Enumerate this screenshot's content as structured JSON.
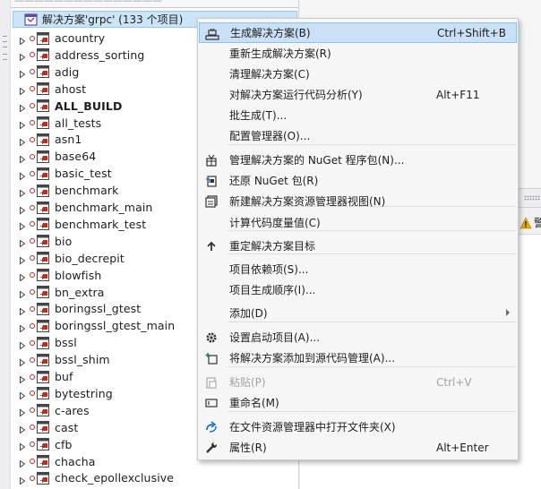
{
  "explorer": {
    "root": {
      "label": "解决方案'grpc' (133 个项目)"
    },
    "projects": [
      {
        "label": "acountry",
        "bold": false
      },
      {
        "label": "address_sorting",
        "bold": false
      },
      {
        "label": "adig",
        "bold": false
      },
      {
        "label": "ahost",
        "bold": false
      },
      {
        "label": "ALL_BUILD",
        "bold": true
      },
      {
        "label": "all_tests",
        "bold": false
      },
      {
        "label": "asn1",
        "bold": false
      },
      {
        "label": "base64",
        "bold": false
      },
      {
        "label": "basic_test",
        "bold": false
      },
      {
        "label": "benchmark",
        "bold": false
      },
      {
        "label": "benchmark_main",
        "bold": false
      },
      {
        "label": "benchmark_test",
        "bold": false
      },
      {
        "label": "bio",
        "bold": false
      },
      {
        "label": "bio_decrepit",
        "bold": false
      },
      {
        "label": "blowfish",
        "bold": false
      },
      {
        "label": "bn_extra",
        "bold": false
      },
      {
        "label": "boringssl_gtest",
        "bold": false
      },
      {
        "label": "boringssl_gtest_main",
        "bold": false
      },
      {
        "label": "bssl",
        "bold": false
      },
      {
        "label": "bssl_shim",
        "bold": false
      },
      {
        "label": "buf",
        "bold": false
      },
      {
        "label": "bytestring",
        "bold": false
      },
      {
        "label": "c-ares",
        "bold": false
      },
      {
        "label": "cast",
        "bold": false
      },
      {
        "label": "cfb",
        "bold": false
      },
      {
        "label": "chacha",
        "bold": false
      },
      {
        "label": "check_epollexclusive",
        "bold": false
      }
    ]
  },
  "right_panel": {
    "warning_text": "警"
  },
  "context_menu": {
    "items": [
      {
        "key": "build",
        "label": "生成解决方案(B)",
        "shortcut": "Ctrl+Shift+B",
        "icon": "build-solution-icon",
        "highlighted": true
      },
      {
        "key": "rebuild",
        "label": "重新生成解决方案(R)",
        "shortcut": ""
      },
      {
        "key": "clean",
        "label": "清理解决方案(C)",
        "shortcut": ""
      },
      {
        "key": "analyze",
        "label": "对解决方案运行代码分析(Y)",
        "shortcut": "Alt+F11"
      },
      {
        "key": "batch",
        "label": "批生成(T)...",
        "shortcut": ""
      },
      {
        "key": "config",
        "label": "配置管理器(O)...",
        "shortcut": ""
      },
      {
        "key": "nuget",
        "label": "管理解决方案的 NuGet 程序包(N)...",
        "shortcut": "",
        "icon": "nuget-package-icon"
      },
      {
        "key": "restore",
        "label": "还原 NuGet 包(R)",
        "shortcut": "",
        "icon": "restore-package-icon"
      },
      {
        "key": "newview",
        "label": "新建解决方案资源管理器视图(N)",
        "shortcut": "",
        "icon": "new-explorer-view-icon"
      },
      {
        "key": "metrics",
        "label": "计算代码度量值(C)",
        "shortcut": ""
      },
      {
        "key": "retarget",
        "label": "重定解决方案目标",
        "shortcut": "",
        "icon": "retarget-arrow-icon"
      },
      {
        "key": "deps",
        "label": "项目依赖项(S)...",
        "shortcut": ""
      },
      {
        "key": "order",
        "label": "项目生成顺序(I)...",
        "shortcut": ""
      },
      {
        "key": "add",
        "label": "添加(D)",
        "shortcut": "",
        "submenu": true
      },
      {
        "key": "startup",
        "label": "设置启动项目(A)...",
        "shortcut": "",
        "icon": "gear-icon"
      },
      {
        "key": "scc",
        "label": "将解决方案添加到源代码管理(A)...",
        "shortcut": "",
        "icon": "add-source-control-icon"
      },
      {
        "key": "paste",
        "label": "粘贴(P)",
        "shortcut": "Ctrl+V",
        "icon": "paste-icon",
        "disabled": true
      },
      {
        "key": "rename",
        "label": "重命名(M)",
        "shortcut": "",
        "icon": "rename-icon"
      },
      {
        "key": "openfolder",
        "label": "在文件资源管理器中打开文件夹(X)",
        "shortcut": "",
        "icon": "refresh-open-icon"
      },
      {
        "key": "props",
        "label": "属性(R)",
        "shortcut": "Alt+Enter",
        "icon": "wrench-icon"
      }
    ]
  },
  "colors": {
    "selection": "#cce4f7",
    "menu_highlight": "#c9e0f7",
    "project_red": "#c42b1c",
    "warning": "#e8a900"
  }
}
